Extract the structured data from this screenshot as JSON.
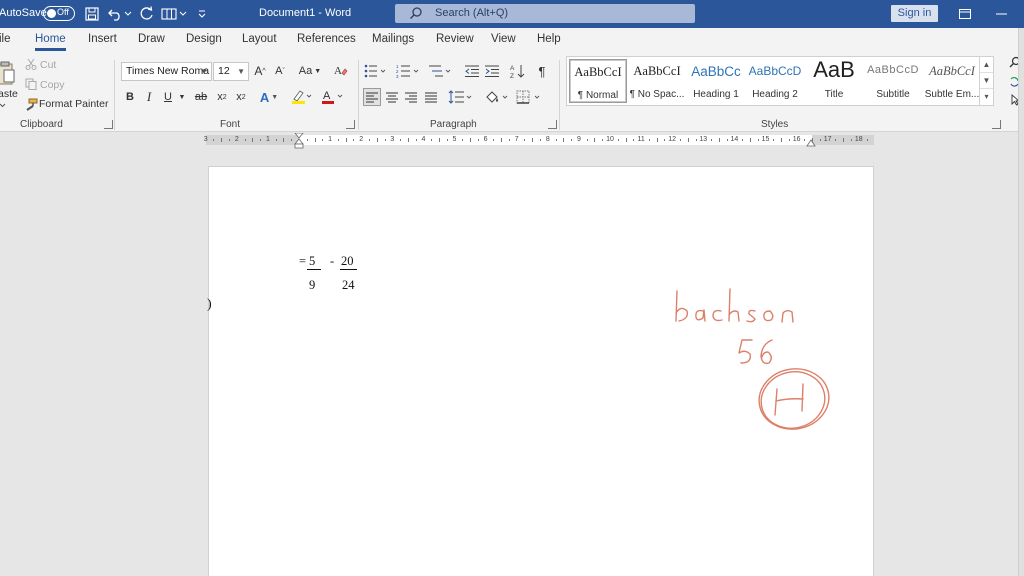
{
  "titlebar": {
    "autosave_label": "AutoSave",
    "autosave_state": "Off",
    "document_title": "Document1  -  Word",
    "search_placeholder": "Search (Alt+Q)",
    "signin_label": "Sign in"
  },
  "tabs": [
    {
      "label": "ile"
    },
    {
      "label": "Home"
    },
    {
      "label": "Insert"
    },
    {
      "label": "Draw"
    },
    {
      "label": "Design"
    },
    {
      "label": "Layout"
    },
    {
      "label": "References"
    },
    {
      "label": "Mailings"
    },
    {
      "label": "Review"
    },
    {
      "label": "View"
    },
    {
      "label": "Help"
    }
  ],
  "clipboard": {
    "paste_label": "aste",
    "cut_label": "Cut",
    "copy_label": "Copy",
    "format_painter_label": "Format Painter",
    "group_label": "Clipboard"
  },
  "font": {
    "font_name": "Times New Roma",
    "font_size": "12",
    "group_label": "Font"
  },
  "paragraph": {
    "group_label": "Paragraph"
  },
  "styles": {
    "group_label": "Styles",
    "items": [
      {
        "sample": "AaBbCcI",
        "name": "¶ Normal"
      },
      {
        "sample": "AaBbCcI",
        "name": "¶ No Spac..."
      },
      {
        "sample": "AaBbCc",
        "name": "Heading 1"
      },
      {
        "sample": "AaBbCcD",
        "name": "Heading 2"
      },
      {
        "sample": "AaB",
        "name": "Title"
      },
      {
        "sample": "AaBbCcD",
        "name": "Subtitle"
      },
      {
        "sample": "AaBbCcI",
        "name": "Subtle Em..."
      }
    ]
  },
  "ruler": {
    "labels": [
      "3",
      "2",
      "1",
      "1",
      "2",
      "3",
      "4",
      "5",
      "6",
      "7",
      "8",
      "9",
      "10",
      "11",
      "12",
      "13",
      "14",
      "15",
      "16",
      "17",
      "18"
    ]
  },
  "document": {
    "equals": "=",
    "num1": "5",
    "den1": "9",
    "minus": "-",
    "num2": "20",
    "den2": "24",
    "paren": ")"
  },
  "colors": {
    "accent": "#2b579a",
    "ink": "#d66a50"
  },
  "ink_annotation": {
    "word": "bachson",
    "number": "56",
    "circled_letter": "H"
  }
}
